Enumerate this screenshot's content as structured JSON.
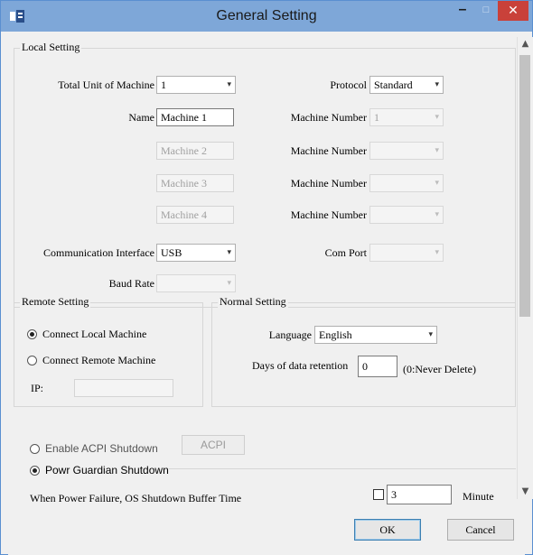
{
  "window": {
    "title": "General Setting",
    "minimize_glyph": "–",
    "maximize_glyph": "□",
    "close_glyph": "✕"
  },
  "local_setting": {
    "title": "Local Setting",
    "total_unit_label": "Total Unit of Machine",
    "total_unit_value": "1",
    "protocol_label": "Protocol",
    "protocol_value": "Standard",
    "name_label": "Name",
    "machines": [
      "Machine 1",
      "Machine 2",
      "Machine 3",
      "Machine 4"
    ],
    "machine_number_label": "Machine Number",
    "machine_number_values": [
      "1",
      "",
      "",
      ""
    ],
    "comm_interface_label": "Communication Interface",
    "comm_interface_value": "USB",
    "com_port_label": "Com Port",
    "com_port_value": "",
    "baud_rate_label": "Baud Rate",
    "baud_rate_value": ""
  },
  "remote_setting": {
    "title": "Remote Setting",
    "connect_local": "Connect Local Machine",
    "connect_remote": "Connect Remote Machine",
    "selected": "connect_local",
    "ip_label": "IP:",
    "ip_value": ""
  },
  "normal_setting": {
    "title": "Normal Setting",
    "language_label": "Language",
    "language_value": "English",
    "retention_label": "Days of data retention",
    "retention_value": "0",
    "retention_hint": "(0:Never Delete)"
  },
  "shutdown": {
    "acpi_label": "Enable ACPI Shutdown",
    "acpi_button": "ACPI",
    "guardian_label": "Powr Guardian Shutdown",
    "selected": "guardian",
    "buffer_label": "When Power Failure, OS Shutdown Buffer Time",
    "buffer_checked": false,
    "buffer_value": "3",
    "buffer_unit": "Minute"
  },
  "buttons": {
    "ok": "OK",
    "cancel": "Cancel"
  },
  "colors": {
    "titlebar": "#7ea7d8",
    "close": "#c9413a",
    "default_button_border": "#3c7fb1"
  },
  "icons": {
    "app": "app-logo-icon",
    "dropdown": "chevron-down-icon",
    "scroll_up": "chevron-up-icon",
    "scroll_down": "chevron-down-icon"
  }
}
